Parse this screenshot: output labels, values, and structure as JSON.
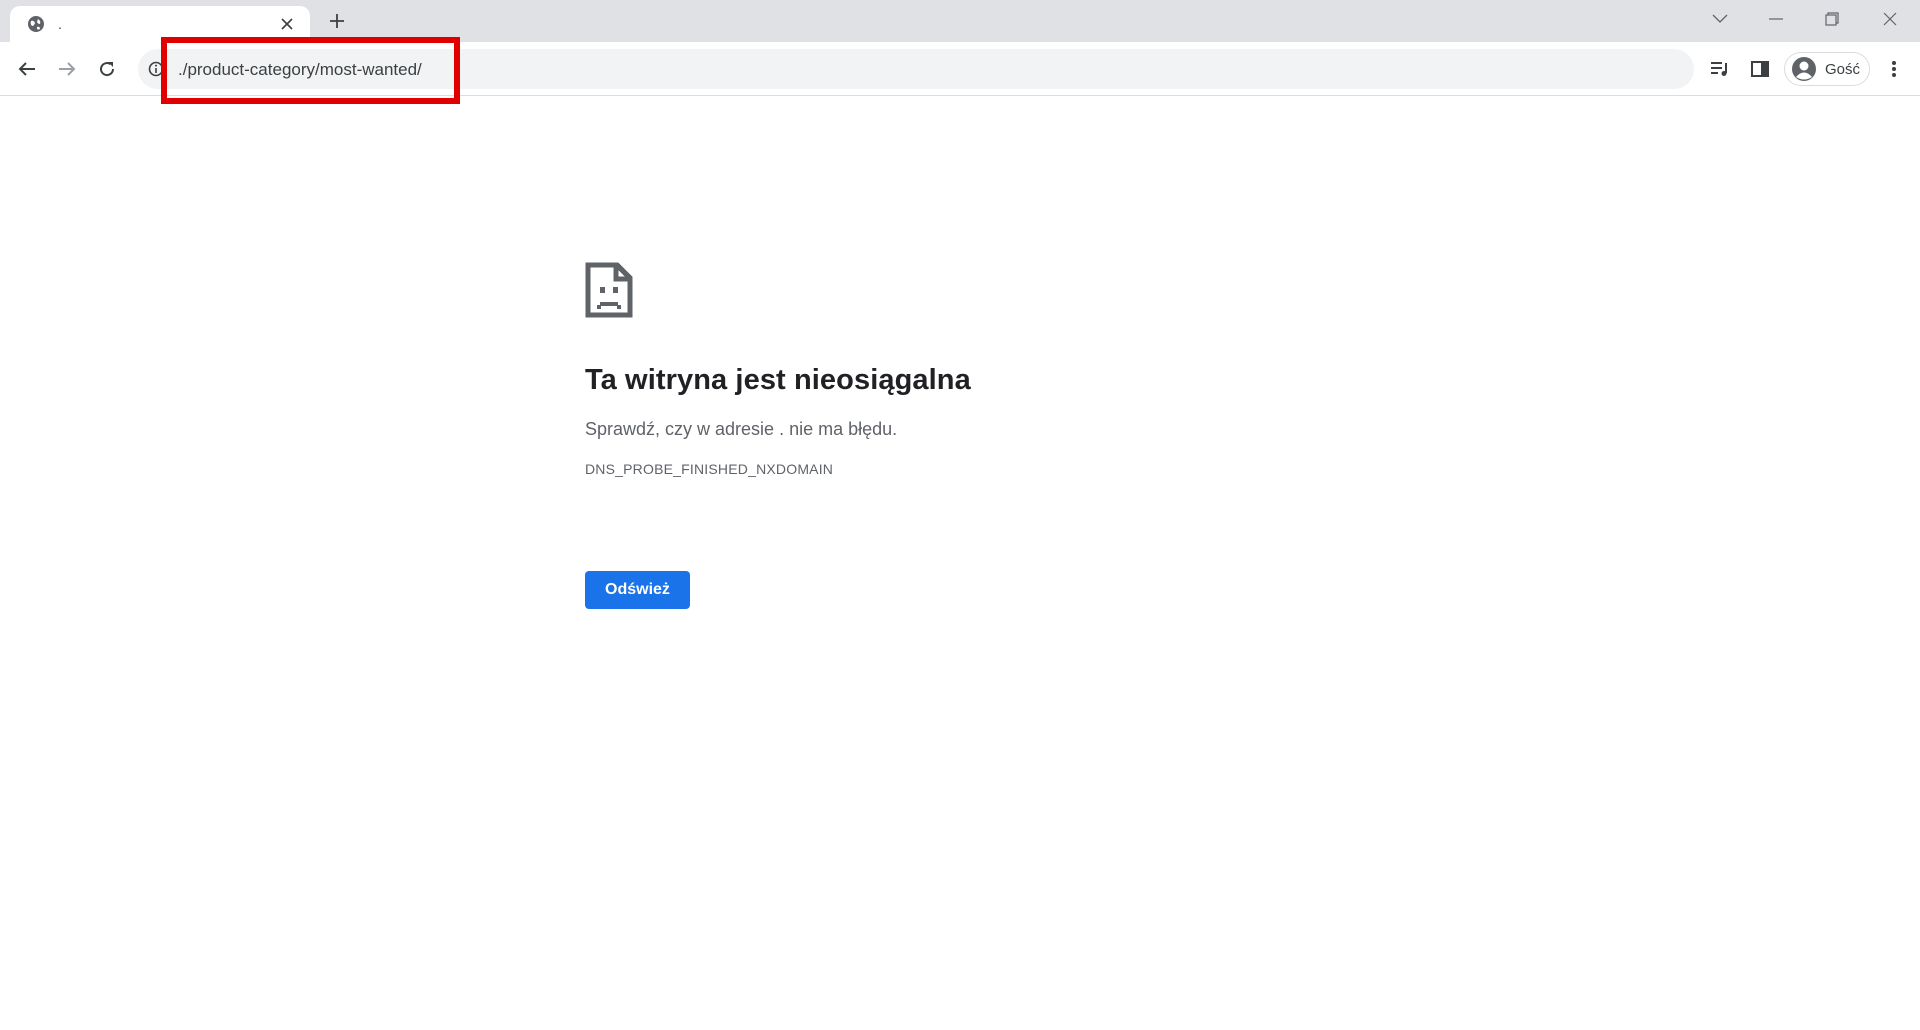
{
  "tab": {
    "title": "."
  },
  "address_bar": {
    "url": "./product-category/most-wanted/"
  },
  "profile": {
    "name": "Gość"
  },
  "error_page": {
    "title": "Ta witryna jest nieosiągalna",
    "description": "Sprawdź, czy w adresie . nie ma błędu.",
    "error_code": "DNS_PROBE_FINISHED_NXDOMAIN",
    "reload_label": "Odśwież"
  },
  "colors": {
    "tabstrip": "#dfe1e5",
    "omnibox": "#f1f3f4",
    "primary_button": "#1a73e8",
    "highlight_box": "#e00000"
  },
  "icons": [
    "globe-icon",
    "close-icon",
    "plus-icon",
    "chevron-down-icon",
    "minimize-icon",
    "restore-icon",
    "window-close-icon",
    "back-arrow-icon",
    "forward-arrow-icon",
    "reload-icon",
    "info-icon",
    "reading-list-icon",
    "side-panel-icon",
    "avatar-icon",
    "kebab-menu-icon",
    "sad-page-icon"
  ]
}
